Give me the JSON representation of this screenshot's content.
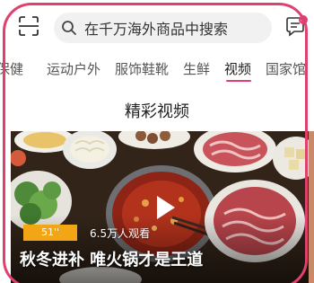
{
  "header": {
    "search_placeholder": "在千万海外商品中搜索",
    "scan_icon": "scan-icon",
    "search_icon": "search-icon",
    "message_icon": "message-icon"
  },
  "tabs": [
    {
      "label": "保健",
      "active": false
    },
    {
      "label": "运动户外",
      "active": false
    },
    {
      "label": "服饰鞋靴",
      "active": false
    },
    {
      "label": "生鲜",
      "active": false
    },
    {
      "label": "视频",
      "active": true
    },
    {
      "label": "国家馆",
      "active": false
    }
  ],
  "section": {
    "title": "精彩视频"
  },
  "video": {
    "duration": "51''",
    "views": "6.5万人观看",
    "title": "秋冬进补 唯火锅才是王道",
    "play_icon": "play-icon"
  },
  "colors": {
    "accent": "#e0406e",
    "badge": "#f2a515",
    "search_bg": "#f1f1f1"
  }
}
